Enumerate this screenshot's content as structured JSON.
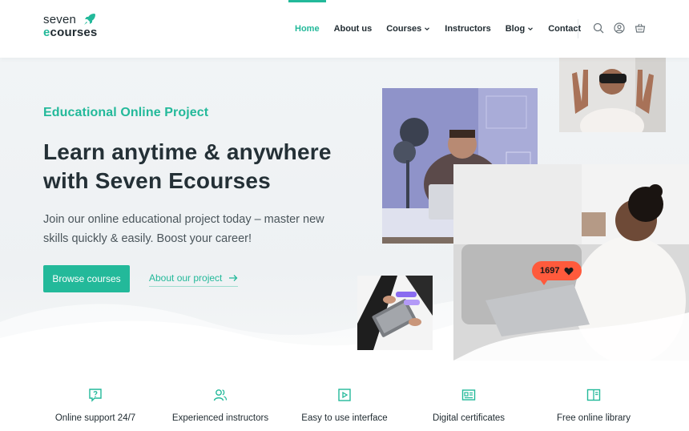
{
  "brand": {
    "line1": "seven",
    "line2_accent": "e",
    "line2_rest": "courses"
  },
  "nav": {
    "items": [
      {
        "label": "Home",
        "active": true,
        "dropdown": false
      },
      {
        "label": "About us",
        "active": false,
        "dropdown": false
      },
      {
        "label": "Courses",
        "active": false,
        "dropdown": true
      },
      {
        "label": "Instructors",
        "active": false,
        "dropdown": false
      },
      {
        "label": "Blog",
        "active": false,
        "dropdown": true
      },
      {
        "label": "Contact",
        "active": false,
        "dropdown": false
      }
    ],
    "icons": [
      "search-icon",
      "user-icon",
      "cart-icon"
    ]
  },
  "hero": {
    "eyebrow": "Educational Online Project",
    "headline_line1": "Learn anytime & anywhere",
    "headline_line2": "with Seven Ecourses",
    "lead_line1": "Join our online educational project today – master new",
    "lead_line2": "skills quickly & easily. Boost your career!",
    "primary_button": "Browse courses",
    "secondary_link": "About our project",
    "likes_badge": "1697"
  },
  "features": [
    {
      "label": "Online support 24/7",
      "icon": "question-bubble-icon"
    },
    {
      "label": "Experienced instructors",
      "icon": "users-icon"
    },
    {
      "label": "Easy to use interface",
      "icon": "play-window-icon"
    },
    {
      "label": "Digital certificates",
      "icon": "certificate-icon"
    },
    {
      "label": "Free online library",
      "icon": "book-icon"
    }
  ],
  "colors": {
    "accent": "#23b99a",
    "text": "#1f2a30",
    "badge": "#ff5a3c",
    "hero_bg": "#f1f4f6"
  }
}
